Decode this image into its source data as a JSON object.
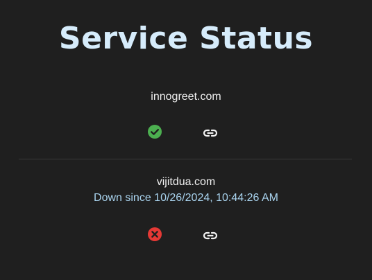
{
  "page": {
    "title": "Service Status"
  },
  "colors": {
    "background": "#1f1f1f",
    "title": "#d6ecfb",
    "status_up": "#4caf50",
    "status_down": "#e53935",
    "down_text": "#a9d3ee"
  },
  "services": [
    {
      "domain": "innogreet.com",
      "status": "up",
      "status_icon": "check-circle-icon",
      "link_icon": "link-icon"
    },
    {
      "domain": "vijitdua.com",
      "status": "down",
      "down_since": "Down since 10/26/2024, 10:44:26 AM",
      "status_icon": "x-circle-icon",
      "link_icon": "link-icon"
    }
  ]
}
